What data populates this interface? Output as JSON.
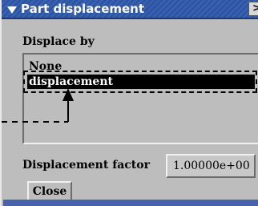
{
  "window": {
    "title": "Part displacement",
    "close_glyph": ">",
    "title_color": "#2d55a3",
    "selection_color": "#000000"
  },
  "displace_by": {
    "label": "Displace by",
    "options": [
      "None",
      "displacement"
    ],
    "selected": "displacement"
  },
  "factor": {
    "label": "Displacement factor",
    "value": "1.00000e+00"
  },
  "buttons": {
    "close_label": "Close"
  },
  "icons": {
    "title_menu": "chevron-down-icon",
    "pointer": "arrow-pointer-icon"
  }
}
